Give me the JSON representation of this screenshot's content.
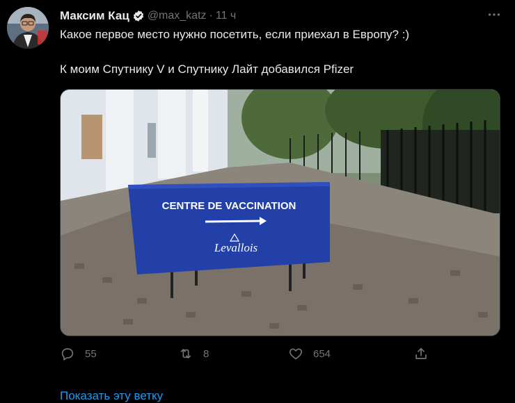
{
  "tweet": {
    "author_name": "Максим Кац",
    "handle": "@max_katz",
    "separator": "·",
    "time": "11 ч",
    "line1": "Какое первое место нужно посетить, если приехал в Европу? :)",
    "line2": "К моим Спутнику V и Спутнику Лайт добавился Pfizer",
    "image": {
      "sign_title": "CENTRE DE VACCINATION",
      "sign_logo": "Levallois"
    },
    "actions": {
      "replies": "55",
      "retweets": "8",
      "likes": "654"
    },
    "show_thread": "Показать эту ветку"
  },
  "colors": {
    "background": "#000000",
    "text": "#e7e9ea",
    "muted": "#71767b",
    "link": "#1d9bf0",
    "sign_blue": "#2340a8"
  }
}
